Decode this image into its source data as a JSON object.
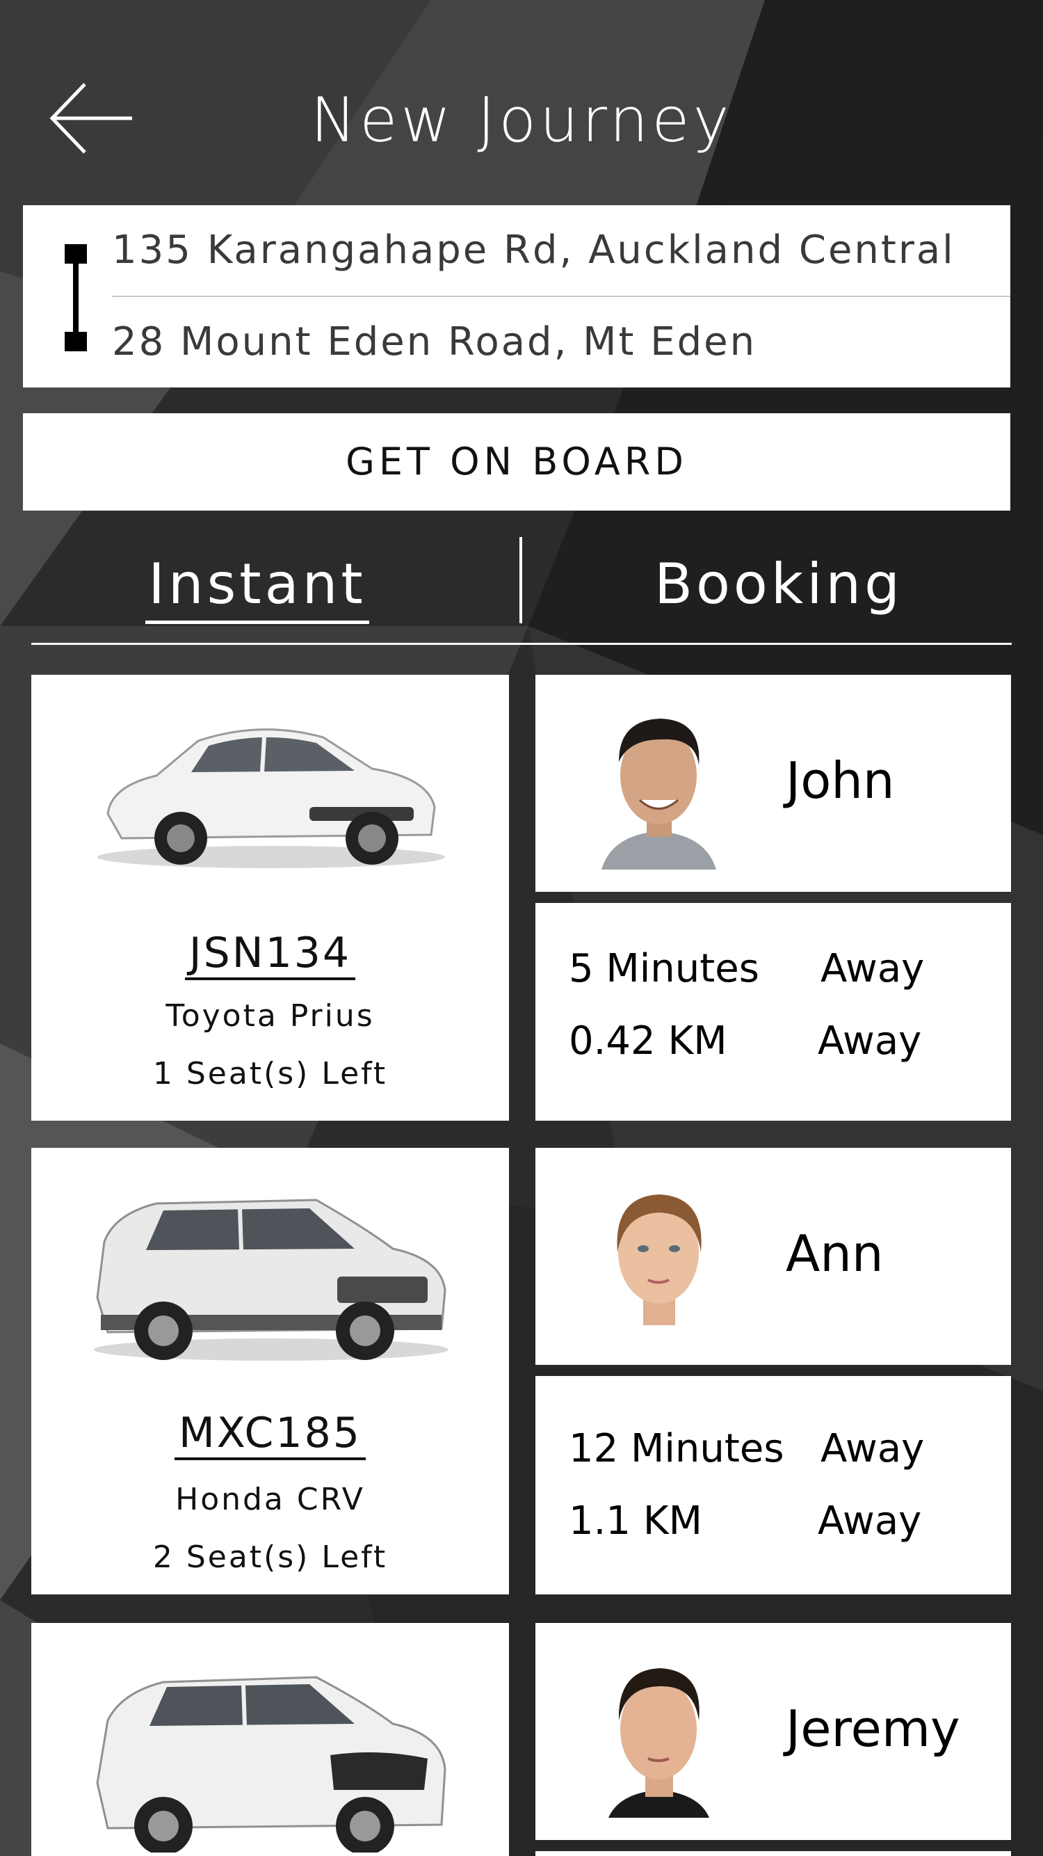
{
  "header": {
    "title": "New Journey"
  },
  "route": {
    "pickup": "135 Karangahape Rd, Auckland Central",
    "dropoff": "28 Mount Eden Road, Mt Eden"
  },
  "board_button": "GET ON BOARD",
  "tabs": {
    "instant": "Instant",
    "booking": "Booking"
  },
  "rides": [
    {
      "plate": "JSN134",
      "model": "Toyota Prius",
      "seats": "1 Seat(s) Left",
      "car_color": "#f2f2f2",
      "driver": "John",
      "minutes": "5 Minutes",
      "distance": "0.42 KM",
      "away": "Away"
    },
    {
      "plate": "MXC185",
      "model": "Honda CRV",
      "seats": "2 Seat(s) Left",
      "car_color": "#e9e9e9",
      "driver": "Ann",
      "minutes": "12 Minutes",
      "distance": "1.1 KM",
      "away": "Away"
    },
    {
      "driver": "Jeremy"
    }
  ],
  "icons": {
    "back": "back-arrow-icon"
  }
}
